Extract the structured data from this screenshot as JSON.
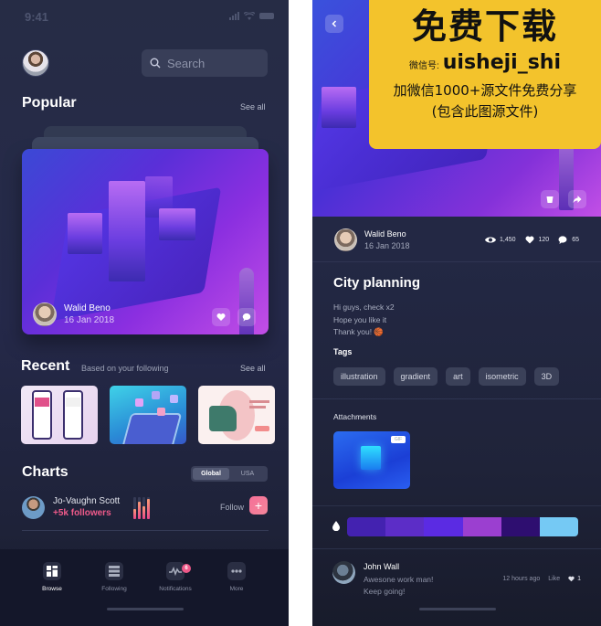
{
  "left_screen": {
    "status_bar": {
      "time": "9:41"
    },
    "search": {
      "placeholder": "Search"
    },
    "popular": {
      "title": "Popular",
      "see_all": "See all",
      "card": {
        "author": "Walid Beno",
        "date": "16 Jan 2018",
        "icons": [
          "heart-icon",
          "comment-icon"
        ]
      }
    },
    "recent": {
      "title": "Recent",
      "subtitle": "Based on your following",
      "see_all": "See all",
      "thumbnails": [
        "mobile app screens",
        "tablet isometric illustration",
        "rocking chair product page"
      ]
    },
    "charts": {
      "title": "Charts",
      "segments": [
        {
          "label": "Global",
          "active": true
        },
        {
          "label": "USA",
          "active": false
        }
      ],
      "entry": {
        "name": "Jo-Vaughn Scott",
        "followers": "+5k followers",
        "bar_levels": [
          0.45,
          0.8,
          0.6,
          0.9
        ],
        "follow_label": "Follow",
        "follow_button": "+"
      }
    },
    "tabbar": {
      "tabs": [
        {
          "label": "Browse",
          "icon": "grid-icon",
          "active": true
        },
        {
          "label": "Following",
          "icon": "list-icon",
          "active": false
        },
        {
          "label": "Notifications",
          "icon": "activity-icon",
          "active": false,
          "badge": "6"
        },
        {
          "label": "More",
          "icon": "more-icon",
          "active": false
        }
      ]
    }
  },
  "right_screen": {
    "promo_overlay": {
      "title": "免费下载",
      "id_label": "微信号:",
      "id_value": "uisheji_shi",
      "line1": "加微信1000+源文件免费分享",
      "line2": "(包含此图源文件)"
    },
    "post": {
      "author": "Walid Beno",
      "date": "16 Jan 2018",
      "stats": {
        "views": "1,450",
        "likes": "120",
        "comments": "65"
      },
      "title": "City planning",
      "body": "Hi guys, check x2\nHope you like it\nThank you! 🏀",
      "tags_label": "Tags",
      "tags": [
        "illustration",
        "gradient",
        "art",
        "isometric",
        "3D"
      ],
      "attachments_label": "Attachments",
      "attachment_badge": "GIF",
      "palette": [
        "#4322b0",
        "#5c2dc7",
        "#5b2be3",
        "#9b3fd0",
        "#2e0e70",
        "#75c9f4"
      ]
    },
    "comment": {
      "author": "John Wall",
      "body": "Awesone work man!\nKeep going!",
      "time": "12 hours ago",
      "like_label": "Like",
      "like_count": "1"
    }
  }
}
